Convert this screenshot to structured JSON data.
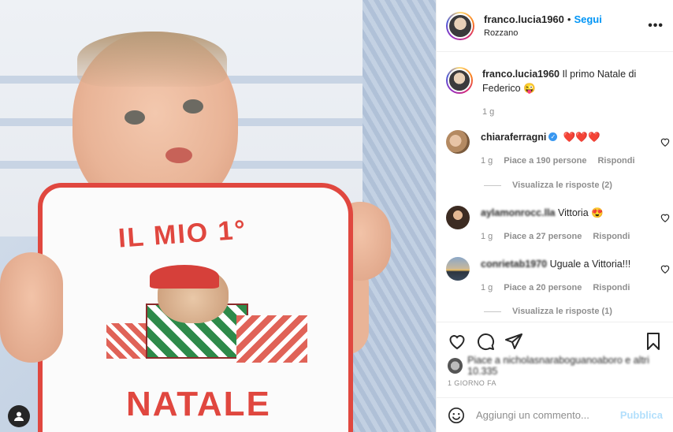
{
  "post_header": {
    "username": "franco.lucia1960",
    "separator": "•",
    "follow_label": "Segui",
    "location": "Rozzano",
    "more_label": "•••"
  },
  "photo": {
    "bib_top_text": "IL MIO 1°",
    "bib_bottom_text": "NATALE"
  },
  "caption": {
    "username": "franco.lucia1960",
    "text": "Il primo Natale di Federico 😜",
    "time": "1 g"
  },
  "comments": [
    {
      "username": "chiaraferragni",
      "verified": true,
      "text": "❤️❤️❤️",
      "time": "1 g",
      "likes": "Piace a 190 persone",
      "reply_label": "Rispondi",
      "view_replies": "Visualizza le risposte (2)"
    },
    {
      "username": "aylamonrocc.lla",
      "text": "Vittoria 😍",
      "time": "1 g",
      "likes": "Piace a 27 persone",
      "reply_label": "Rispondi"
    },
    {
      "username": "conrietab1970",
      "text": "Uguale a Vittoria!!!",
      "time": "1 g",
      "likes": "Piace a 20 persone",
      "reply_label": "Rispondi",
      "view_replies": "Visualizza le risposte (1)"
    }
  ],
  "likes_line": "Piace a nicholasnaraboguanoaboro e altri 10.335",
  "post_time": "1 GIORNO FA",
  "add_comment": {
    "placeholder": "Aggiungi un commento...",
    "post_label": "Pubblica"
  },
  "colors": {
    "link_blue": "#0095f6",
    "muted": "#8e8e8e",
    "bib_red": "#e0473f",
    "post_disabled": "#b2dffc"
  }
}
